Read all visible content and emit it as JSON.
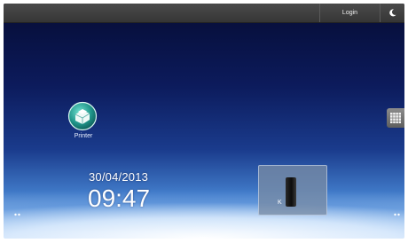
{
  "topbar": {
    "login_label": "Login",
    "night_mode_icon": "moon-icon"
  },
  "apps": [
    {
      "label": "Printer",
      "icon": "printer-app-icon"
    }
  ],
  "clock": {
    "date": "30/04/2013",
    "time": "09:47"
  },
  "toner_widget": {
    "label": "K",
    "icon": "toner-cartridge-icon"
  },
  "app_drawer_icon": "grid-icon",
  "colors": {
    "topbar": "#3d3d3d",
    "sky_top": "#060c34",
    "sky_mid": "#1a3b8c",
    "horizon": "#eef6ff",
    "printer_icon": "#2aa59a",
    "widget_panel": "#7889a2"
  }
}
